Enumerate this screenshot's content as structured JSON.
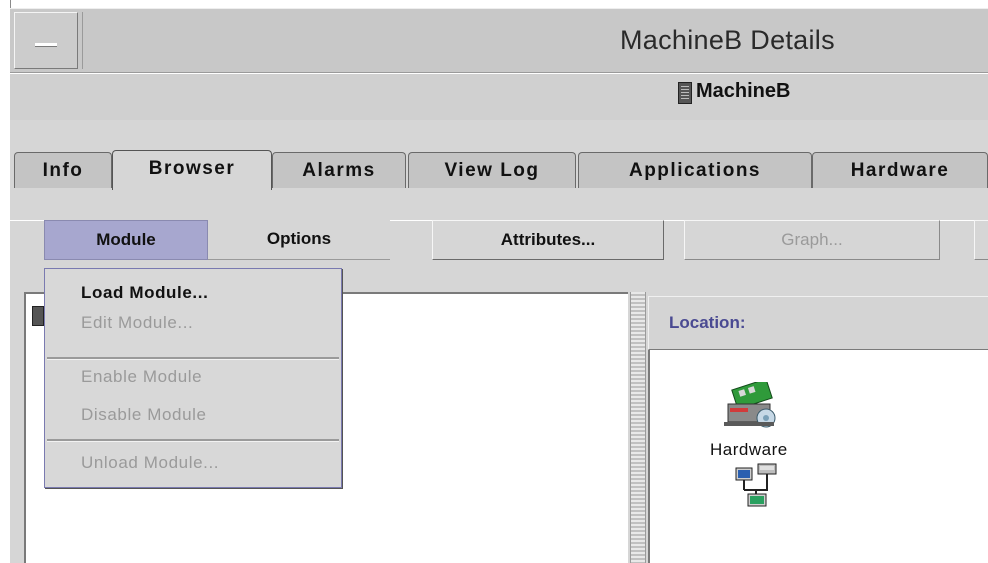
{
  "window": {
    "title": "MachineB Details",
    "host_name": "MachineB"
  },
  "tabs": [
    {
      "label": "Info"
    },
    {
      "label": "Browser"
    },
    {
      "label": "Alarms"
    },
    {
      "label": "View Log"
    },
    {
      "label": "Applications"
    },
    {
      "label": "Hardware"
    }
  ],
  "active_tab": "Browser",
  "toolbar": {
    "module_label": "Module",
    "options_label": "Options",
    "attributes_label": "Attributes...",
    "graph_label": "Graph..."
  },
  "module_menu": {
    "items": [
      {
        "label": "Load Module...",
        "enabled": true
      },
      {
        "label": "Edit Module...",
        "enabled": false
      },
      {
        "label": "Enable Module",
        "enabled": false
      },
      {
        "label": "Disable Module",
        "enabled": false
      },
      {
        "label": "Unload Module...",
        "enabled": false
      }
    ]
  },
  "details_panel": {
    "location_label": "Location:",
    "items": [
      {
        "label": "Hardware",
        "icon": "hardware-icon"
      },
      {
        "label": "",
        "icon": "network-icon"
      }
    ]
  },
  "colors": {
    "menu_highlight": "#a7a7cf",
    "location_text": "#4a4a92",
    "background": "#d6d6d6"
  }
}
